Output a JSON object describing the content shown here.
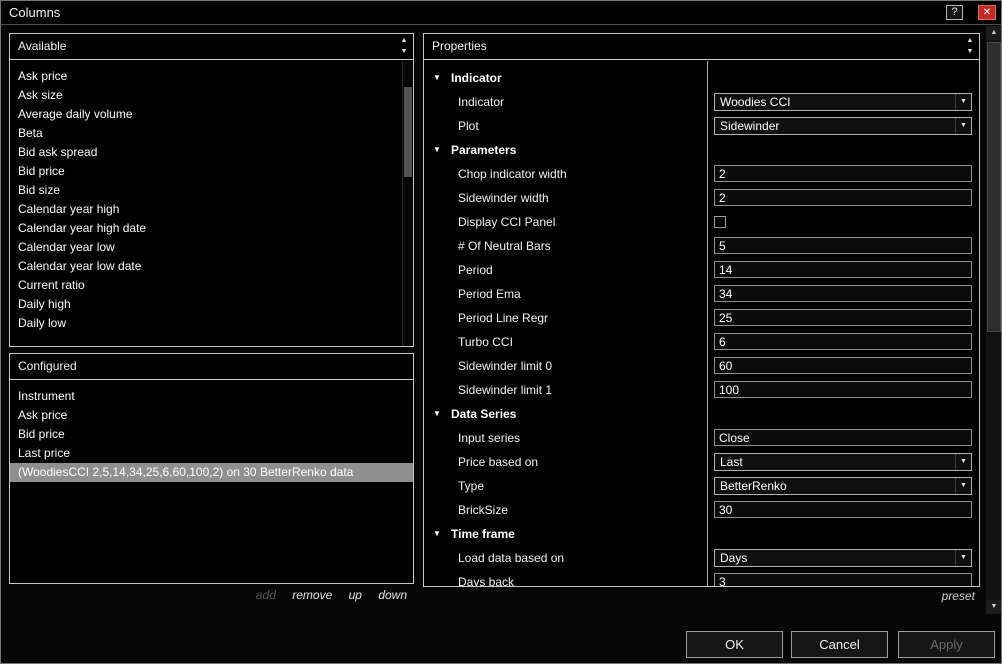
{
  "window": {
    "title": "Columns"
  },
  "icons": {
    "help": "?",
    "close": "✕",
    "scroll_up": "▲",
    "scroll_down": "▼",
    "expander": "▼",
    "combo_arrow": "▼"
  },
  "panels": {
    "available": {
      "title": "Available",
      "items": [
        "Ask price",
        "Ask size",
        "Average daily volume",
        "Beta",
        "Bid ask spread",
        "Bid price",
        "Bid size",
        "Calendar year high",
        "Calendar year high date",
        "Calendar year low",
        "Calendar year low date",
        "Current ratio",
        "Daily high",
        "Daily low"
      ]
    },
    "configured": {
      "title": "Configured",
      "items": [
        "Instrument",
        "Ask price",
        "Bid price",
        "Last price",
        "(WoodiesCCI 2,5,14,34,25,6,60,100,2) on 30 BetterRenko data"
      ],
      "selected_index": 4
    },
    "properties": {
      "title": "Properties",
      "preset": "preset"
    }
  },
  "actions": {
    "add": "add",
    "remove": "remove",
    "up": "up",
    "down": "down"
  },
  "properties_rows": [
    {
      "type": "group",
      "label": "Indicator"
    },
    {
      "type": "combo",
      "label": "Indicator",
      "value": "Woodies CCI"
    },
    {
      "type": "combo",
      "label": "Plot",
      "value": "Sidewinder"
    },
    {
      "type": "group",
      "label": "Parameters"
    },
    {
      "type": "text",
      "label": "Chop indicator width",
      "value": "2"
    },
    {
      "type": "text",
      "label": "Sidewinder width",
      "value": "2"
    },
    {
      "type": "check",
      "label": "Display CCI Panel",
      "checked": false
    },
    {
      "type": "text",
      "label": "# Of Neutral Bars",
      "value": "5"
    },
    {
      "type": "text",
      "label": "Period",
      "value": "14"
    },
    {
      "type": "text",
      "label": "Period Ema",
      "value": "34"
    },
    {
      "type": "text",
      "label": "Period Line Regr",
      "value": "25"
    },
    {
      "type": "text",
      "label": "Turbo CCI",
      "value": "6"
    },
    {
      "type": "text",
      "label": "Sidewinder limit 0",
      "value": "60"
    },
    {
      "type": "text",
      "label": "Sidewinder limit 1",
      "value": "100"
    },
    {
      "type": "group",
      "label": "Data Series"
    },
    {
      "type": "text",
      "label": "Input series",
      "value": "Close"
    },
    {
      "type": "combo",
      "label": "Price based on",
      "value": "Last"
    },
    {
      "type": "combo",
      "label": "Type",
      "value": "BetterRenko"
    },
    {
      "type": "text",
      "label": "BrickSize",
      "value": "30"
    },
    {
      "type": "group",
      "label": "Time frame"
    },
    {
      "type": "combo",
      "label": "Load data based on",
      "value": "Days"
    },
    {
      "type": "text",
      "label": "Days back",
      "value": "3"
    }
  ],
  "footer": {
    "ok": "OK",
    "cancel": "Cancel",
    "apply": "Apply"
  }
}
